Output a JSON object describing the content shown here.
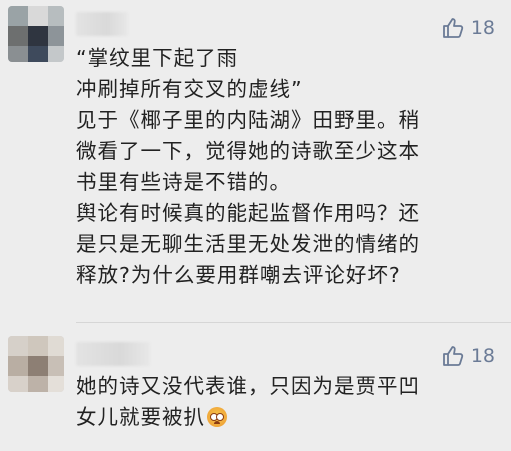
{
  "comments": [
    {
      "likes": "18",
      "lines": [
        "“掌纹里下起了雨",
        "冲刷掉所有交叉的虚线”",
        "见于《椰子里的内陆湖》田野里。稍",
        "微看了一下，觉得她的诗歌至少这本",
        "书里有些诗是不错的。",
        "舆论有时候真的能起监督作用吗？还",
        "是只是无聊生活里无处发泄的情绪的",
        "释放?为什么要用群嘲去评论好坏?"
      ]
    },
    {
      "likes": "18",
      "lines": [
        "她的诗又没代表谁，只因为是贾平凹",
        "女儿就要被扒"
      ],
      "emoji": "flushed-face-emoji"
    }
  ],
  "colors": {
    "background": "#ededed",
    "text": "#222222",
    "like": "#6b7b96"
  }
}
